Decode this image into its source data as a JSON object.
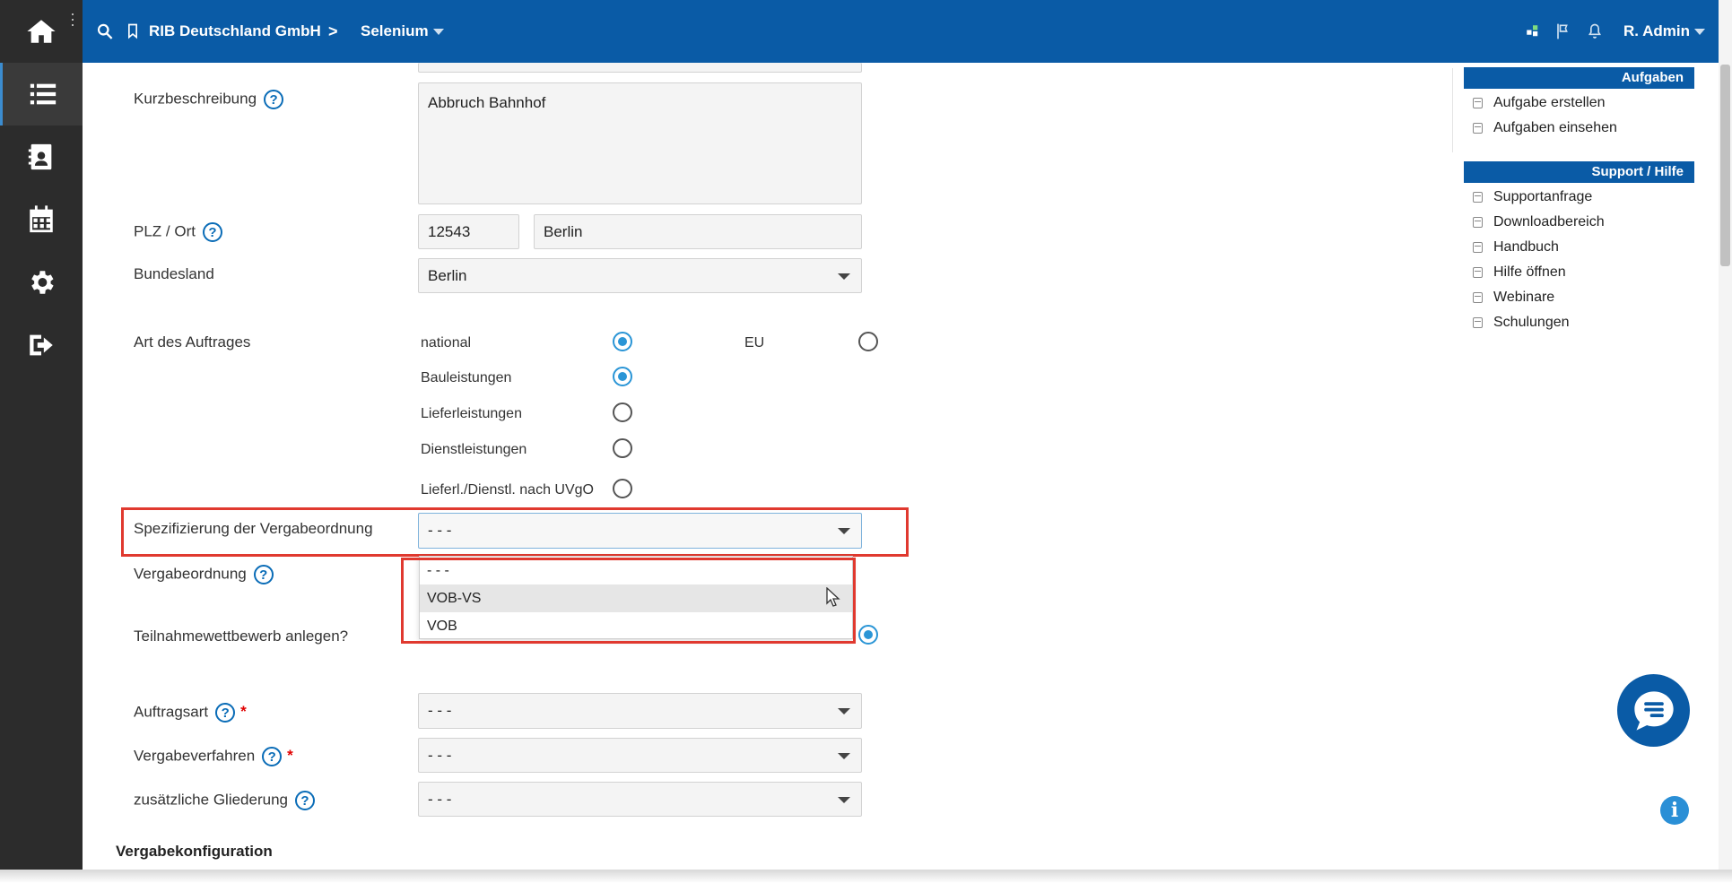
{
  "header": {
    "org": "RIB Deutschland GmbH",
    "separator": ">",
    "project": "Selenium",
    "user": "R. Admin"
  },
  "rail": {
    "icons": [
      "home-icon",
      "list-icon",
      "contacts-icon",
      "calendar-icon",
      "gear-icon",
      "logout-icon"
    ],
    "active": "list-icon"
  },
  "form": {
    "kurzbeschreibung": {
      "label": "Kurzbeschreibung",
      "value": "Abbruch Bahnhof"
    },
    "plz_ort": {
      "label": "PLZ / Ort",
      "plz": "12543",
      "ort": "Berlin"
    },
    "bundesland": {
      "label": "Bundesland",
      "value": "Berlin"
    },
    "art_des_auftrages": {
      "label": "Art des Auftrages",
      "scope": {
        "national": "national",
        "eu": "EU",
        "selected": "national"
      },
      "types": [
        "Bauleistungen",
        "Lieferleistungen",
        "Dienstleistungen",
        "Lieferl./Dienstl. nach UVgO"
      ],
      "selected_type": "Bauleistungen"
    },
    "spezifizierung": {
      "label": "Spezifizierung der Vergabeordnung",
      "value": "- - -",
      "options": [
        "- - -",
        "VOB-VS",
        "VOB"
      ],
      "hovered": "VOB-VS"
    },
    "vergabeordnung": {
      "label": "Vergabeordnung"
    },
    "teilnahmewettbewerb": {
      "label": "Teilnahmewettbewerb anlegen?"
    },
    "auftragsart": {
      "label": "Auftragsart",
      "required": "*",
      "value": "- - -"
    },
    "vergabeverfahren": {
      "label": "Vergabeverfahren",
      "required": "*",
      "value": "- - -"
    },
    "gliederung": {
      "label": "zusätzliche Gliederung",
      "value": "- - -"
    }
  },
  "section": {
    "title": "Vergabekonfiguration"
  },
  "panel": {
    "aufgaben": {
      "title": "Aufgaben",
      "links": [
        "Aufgabe erstellen",
        "Aufgaben einsehen"
      ]
    },
    "support": {
      "title": "Support / Hilfe",
      "links": [
        "Supportanfrage",
        "Downloadbereich",
        "Handbuch",
        "Hilfe öffnen",
        "Webinare",
        "Schulungen"
      ]
    }
  },
  "colors": {
    "brand": "#0a5ba6",
    "accent": "#2a95d6",
    "highlight": "#e0392f",
    "rail": "#2c2c2c"
  }
}
